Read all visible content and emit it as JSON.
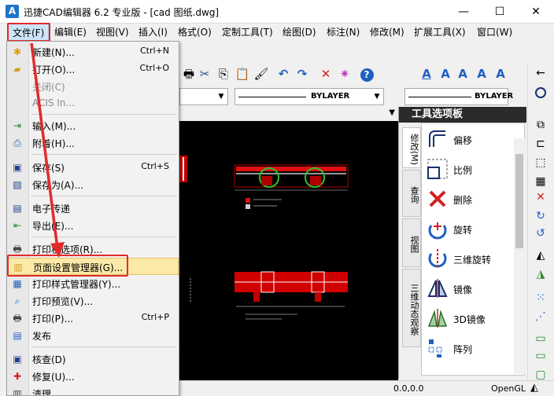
{
  "window": {
    "title": "迅捷CAD编辑器 6.2 专业版  - [cad 图纸.dwg]",
    "logo_text": "A"
  },
  "menubar": {
    "items": [
      {
        "label": "文件(F)"
      },
      {
        "label": "编辑(E)"
      },
      {
        "label": "视图(V)"
      },
      {
        "label": "插入(I)"
      },
      {
        "label": "格式(O)"
      },
      {
        "label": "定制工具(T)"
      },
      {
        "label": "绘图(D)"
      },
      {
        "label": "标注(N)"
      },
      {
        "label": "修改(M)"
      },
      {
        "label": "扩展工具(X)"
      },
      {
        "label": "窗口(W)"
      }
    ]
  },
  "file_menu": {
    "items": [
      {
        "label": "新建(N)...",
        "shortcut": "Ctrl+N"
      },
      {
        "label": "打开(O)...",
        "shortcut": "Ctrl+O"
      },
      {
        "label": "关闭(C)",
        "shortcut": ""
      },
      {
        "label": "ACIS In...",
        "shortcut": ""
      },
      {
        "label": "输入(M)...",
        "shortcut": ""
      },
      {
        "label": "附着(H)...",
        "shortcut": ""
      },
      {
        "label": "保存(S)",
        "shortcut": "Ctrl+S"
      },
      {
        "label": "保存为(A)...",
        "shortcut": ""
      },
      {
        "label": "电子传递",
        "shortcut": ""
      },
      {
        "label": "导出(E)...",
        "shortcut": ""
      },
      {
        "label": "打印机选项(R)...",
        "shortcut": ""
      },
      {
        "label": "页面设置管理器(G)...",
        "shortcut": ""
      },
      {
        "label": "打印样式管理器(Y)...",
        "shortcut": ""
      },
      {
        "label": "打印预览(V)...",
        "shortcut": ""
      },
      {
        "label": "打印(P)...",
        "shortcut": "Ctrl+P"
      },
      {
        "label": "发布",
        "shortcut": ""
      },
      {
        "label": "核查(D)",
        "shortcut": ""
      },
      {
        "label": "修复(U)...",
        "shortcut": ""
      },
      {
        "label": "清理",
        "shortcut": ""
      }
    ]
  },
  "toolbar": {
    "layer_combo": "BYLAYER",
    "linetype_combo": "BYLAYER"
  },
  "palette": {
    "title": "工具选项板",
    "tabs": [
      "修改(M)",
      "查询",
      "视图",
      "三维动态观察"
    ],
    "items": [
      {
        "label": "偏移"
      },
      {
        "label": "比例"
      },
      {
        "label": "删除"
      },
      {
        "label": "旋转"
      },
      {
        "label": "三维旋转"
      },
      {
        "label": "镜像"
      },
      {
        "label": "3D镜像"
      },
      {
        "label": "阵列"
      }
    ]
  },
  "statusbar": {
    "coords": "0.0,0.0",
    "renderer": "OpenGL"
  },
  "colors": {
    "highlight_red": "#e32a2a",
    "menu_hover": "#fbe9a8",
    "accent_blue": "#1f74c9"
  }
}
